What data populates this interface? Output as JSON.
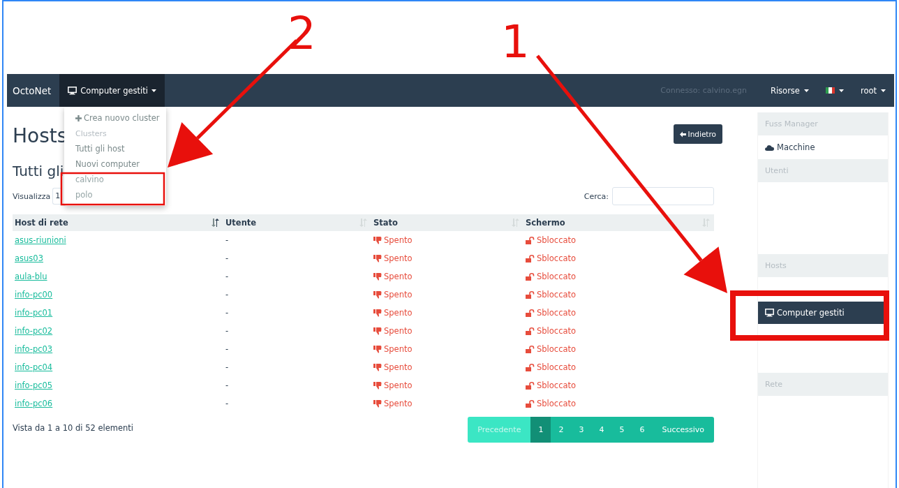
{
  "navbar": {
    "brand": "OctoNet",
    "menu": {
      "label": "Computer gestiti",
      "expanded": true
    },
    "status": "Connesso: calvino.egn",
    "right_menus": [
      {
        "label": "Risorse",
        "kind": "text"
      },
      {
        "kind": "flag"
      },
      {
        "label": "root",
        "kind": "text"
      }
    ]
  },
  "dropdown": [
    {
      "label": "Crea nuovo cluster",
      "kind": "action"
    },
    {
      "label": "Clusters",
      "kind": "header"
    },
    {
      "label": "Tutti gli host",
      "kind": "item"
    },
    {
      "label": "Nuovi computer",
      "kind": "item"
    },
    {
      "label": "calvino",
      "kind": "cluster"
    },
    {
      "label": "polo",
      "kind": "cluster"
    }
  ],
  "page": {
    "title": "Hosts",
    "back_button": "Indietro",
    "subtitle": "Tutti gli",
    "show_label": "Visualizza",
    "show_value": "1",
    "search_label": "Cerca:"
  },
  "table": {
    "columns": [
      {
        "label": "Host di rete",
        "sorted": true
      },
      {
        "label": "Utente",
        "sorted": false
      },
      {
        "label": "Stato",
        "sorted": false
      },
      {
        "label": "Schermo",
        "sorted": false
      }
    ],
    "rows": [
      {
        "host": "asus-riunioni",
        "user": "-",
        "state": "Spento",
        "screen": "Sbloccato"
      },
      {
        "host": "asus03",
        "user": "-",
        "state": "Spento",
        "screen": "Sbloccato"
      },
      {
        "host": "aula-blu",
        "user": "-",
        "state": "Spento",
        "screen": "Sbloccato"
      },
      {
        "host": "info-pc00",
        "user": "-",
        "state": "Spento",
        "screen": "Sbloccato"
      },
      {
        "host": "info-pc01",
        "user": "-",
        "state": "Spento",
        "screen": "Sbloccato"
      },
      {
        "host": "info-pc02",
        "user": "-",
        "state": "Spento",
        "screen": "Sbloccato"
      },
      {
        "host": "info-pc03",
        "user": "-",
        "state": "Spento",
        "screen": "Sbloccato"
      },
      {
        "host": "info-pc04",
        "user": "-",
        "state": "Spento",
        "screen": "Sbloccato"
      },
      {
        "host": "info-pc05",
        "user": "-",
        "state": "Spento",
        "screen": "Sbloccato"
      },
      {
        "host": "info-pc06",
        "user": "-",
        "state": "Spento",
        "screen": "Sbloccato"
      }
    ],
    "info": "Vista da 1 a 10 di 52 elementi"
  },
  "pagination": [
    {
      "label": "Precedente",
      "kind": "prev",
      "selected": false,
      "disabled": true
    },
    {
      "label": "1",
      "kind": "page",
      "selected": true,
      "disabled": false
    },
    {
      "label": "2",
      "kind": "page",
      "selected": false,
      "disabled": false
    },
    {
      "label": "3",
      "kind": "page",
      "selected": false,
      "disabled": false
    },
    {
      "label": "4",
      "kind": "page",
      "selected": false,
      "disabled": false
    },
    {
      "label": "5",
      "kind": "page",
      "selected": false,
      "disabled": false
    },
    {
      "label": "6",
      "kind": "page",
      "selected": false,
      "disabled": false
    },
    {
      "label": "Successivo",
      "kind": "next",
      "selected": false,
      "disabled": false
    }
  ],
  "sidebar": {
    "sections": [
      {
        "title": "Fuss Manager",
        "items": [
          {
            "label": "Macchine",
            "selected": false
          }
        ]
      },
      {
        "title": "Utenti"
      },
      {
        "title": "Hosts",
        "items": [
          {
            "label": "Computer gestiti",
            "selected": true
          }
        ]
      },
      {
        "title": "Rete"
      }
    ]
  },
  "annotations": [
    {
      "label": "2"
    },
    {
      "label": "1"
    }
  ]
}
